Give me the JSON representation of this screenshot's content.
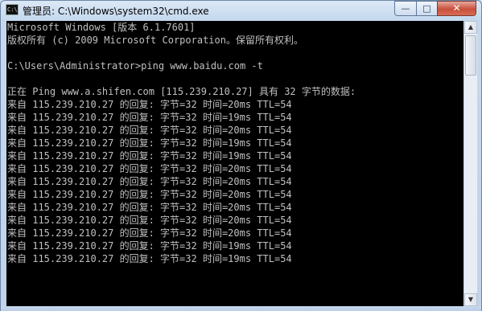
{
  "window": {
    "title": "管理员: C:\\Windows\\system32\\cmd.exe",
    "icon_text": "C:\\",
    "controls": {
      "minimize": "—",
      "maximize": "□",
      "close": "✕"
    }
  },
  "console": {
    "lines": [
      "Microsoft Windows [版本 6.1.7601]",
      "版权所有 (c) 2009 Microsoft Corporation。保留所有权利。",
      "",
      "C:\\Users\\Administrator>ping www.baidu.com -t",
      "",
      "正在 Ping www.a.shifen.com [115.239.210.27] 具有 32 字节的数据:",
      "来自 115.239.210.27 的回复: 字节=32 时间=20ms TTL=54",
      "来自 115.239.210.27 的回复: 字节=32 时间=19ms TTL=54",
      "来自 115.239.210.27 的回复: 字节=32 时间=20ms TTL=54",
      "来自 115.239.210.27 的回复: 字节=32 时间=19ms TTL=54",
      "来自 115.239.210.27 的回复: 字节=32 时间=19ms TTL=54",
      "来自 115.239.210.27 的回复: 字节=32 时间=20ms TTL=54",
      "来自 115.239.210.27 的回复: 字节=32 时间=20ms TTL=54",
      "来自 115.239.210.27 的回复: 字节=32 时间=20ms TTL=54",
      "来自 115.239.210.27 的回复: 字节=32 时间=20ms TTL=54",
      "来自 115.239.210.27 的回复: 字节=32 时间=20ms TTL=54",
      "来自 115.239.210.27 的回复: 字节=32 时间=20ms TTL=54",
      "来自 115.239.210.27 的回复: 字节=32 时间=19ms TTL=54",
      "来自 115.239.210.27 的回复: 字节=32 时间=19ms TTL=54"
    ]
  },
  "scrollbar": {
    "up_arrow": "▲",
    "down_arrow": "▼"
  }
}
